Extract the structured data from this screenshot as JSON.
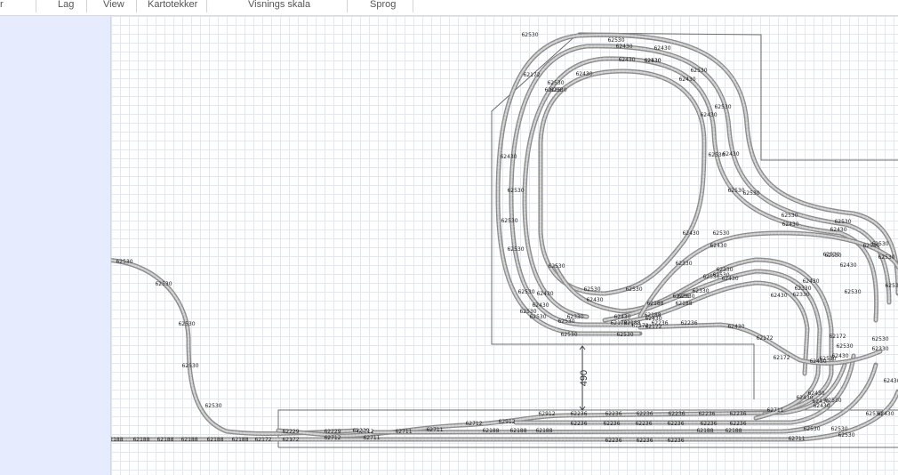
{
  "menu": {
    "items": [
      "r",
      "Lag",
      "View",
      "Kartotekker",
      "Visnings skala",
      "Sprog"
    ]
  },
  "canvas": {
    "dimension_label": "490",
    "colors": {
      "rail": "#8c8c8c",
      "sleeper": "#cfcfcf",
      "board": "#6e6e6e",
      "grid": "#e3e7f0",
      "panel": "#e6ecfd"
    }
  },
  "labels": {
    "l1": "62530",
    "l2": "62530",
    "l3": "62530",
    "l4": "62530",
    "l5": "62530",
    "l6": "62530",
    "l7": "62530",
    "l8": "62530",
    "l9": "62530",
    "l10": "62530",
    "l11": "62530",
    "l12": "62188",
    "l13": "62188",
    "l14": "62188",
    "l15": "62188",
    "l16": "62188",
    "l17": "62188",
    "l18": "62172",
    "l19": "62172",
    "l20": "62229",
    "l21": "62229",
    "l22": "62229",
    "l23": "62711",
    "l24": "62711",
    "l25": "62711",
    "l26": "62712",
    "l27": "62712",
    "l28": "62712",
    "l29": "62912",
    "l30": "62912",
    "l31": "62236",
    "l32": "62236",
    "l33": "62236",
    "l34": "62236",
    "l35": "62236",
    "l36": "62236",
    "l37": "62236",
    "l38": "62236",
    "l39": "62236",
    "l40": "62236",
    "l41": "62236",
    "l42": "62236",
    "l43": "62236",
    "l44": "62236",
    "l45": "62236",
    "l46": "62188",
    "l47": "62188",
    "l48": "62188",
    "l49": "62188",
    "l50": "62188",
    "l51": "62711",
    "l52": "62711",
    "l53": "62530",
    "l54": "62530",
    "l55": "62430",
    "l56": "62430",
    "l57": "62430",
    "l58": "62430",
    "l59": "62188",
    "l60": "62530",
    "l61": "62430",
    "l62": "62530",
    "l63": "62530",
    "l64": "62430",
    "l65": "62430",
    "l66": "62530",
    "l67": "62530",
    "l68": "62430",
    "l69": "62530",
    "l70": "62530",
    "l71": "62530",
    "l72": "62430",
    "l73": "62530",
    "l74": "62430",
    "l75": "62330",
    "l76": "62330",
    "l77": "62430",
    "l78": "62530",
    "l79": "62430",
    "l80": "62530",
    "l81": "62430",
    "l82": "62330",
    "l83": "62530",
    "l84": "62530",
    "l85": "62330",
    "l86": "62330",
    "l87": "62330",
    "l88": "62236",
    "l89": "62188",
    "l90": "62188",
    "l91": "62188",
    "l92": "62188",
    "l93": "62236",
    "l94": "62236",
    "l95": "62430",
    "l96": "62172",
    "l97": "62172",
    "l98": "62530",
    "l99": "62430",
    "l100": "62530",
    "l101": "62430",
    "l102": "62530",
    "l103": "62530",
    "l104": "62530",
    "l105": "62430",
    "l106": "62430",
    "l107": "62530",
    "l108": "62430",
    "l109": "62530",
    "l110": "62330",
    "l111": "62430",
    "l112": "62530",
    "l113": "62530",
    "l114": "62430",
    "l115": "62172",
    "l116": "62172",
    "l117": "62172",
    "l118": "62172",
    "l119": "62530",
    "l120": "62430",
    "l121": "62530",
    "l122": "62530",
    "l123": "62530",
    "l124": "62530",
    "l125": "62530",
    "l126": "62530",
    "l127": "62530",
    "l128": "62430",
    "l129": "62530",
    "l130": "62530",
    "l131": "62430",
    "l132": "62530",
    "l133": "62430",
    "l134": "62530",
    "l135": "62530",
    "l136": "62530",
    "l137": "62172",
    "l138": "62430",
    "l139": "62430",
    "l140": "62430",
    "l141": "62430",
    "l142": "62530",
    "l143": "62530",
    "l144": "62530",
    "l145": "62430",
    "l146": "62430",
    "l147": "62530",
    "l148": "62330",
    "l149": "62530",
    "l150": "62530",
    "l151": "62430"
  }
}
